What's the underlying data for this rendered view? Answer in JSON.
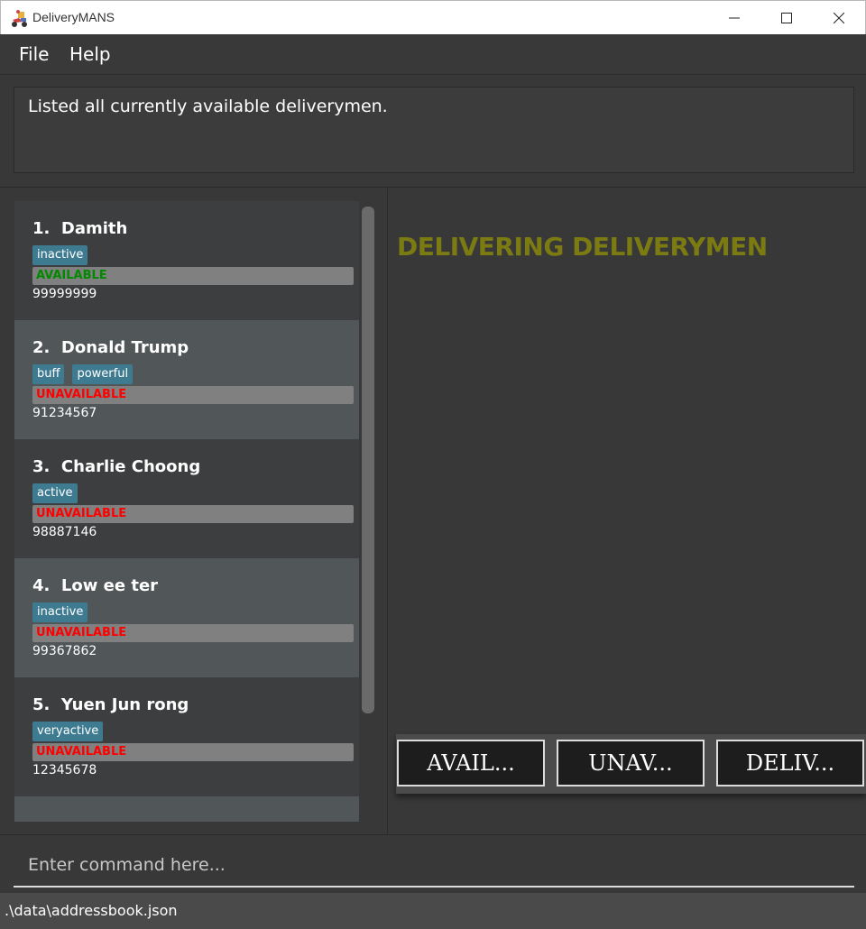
{
  "window": {
    "title": "DeliveryMANS"
  },
  "menu": {
    "file": "File",
    "help": "Help"
  },
  "result": {
    "message": "Listed all currently available deliverymen."
  },
  "deliverymen": [
    {
      "index": "1.",
      "name": "Damith",
      "tags": [
        "inactive"
      ],
      "status": "AVAILABLE",
      "phone": "99999999"
    },
    {
      "index": "2.",
      "name": "Donald Trump",
      "tags": [
        "buff",
        "powerful"
      ],
      "status": "UNAVAILABLE",
      "phone": "91234567"
    },
    {
      "index": "3.",
      "name": "Charlie Choong",
      "tags": [
        "active"
      ],
      "status": "UNAVAILABLE",
      "phone": "98887146"
    },
    {
      "index": "4.",
      "name": "Low ee ter",
      "tags": [
        "inactive"
      ],
      "status": "UNAVAILABLE",
      "phone": "99367862"
    },
    {
      "index": "5.",
      "name": "Yuen Jun rong",
      "tags": [
        "veryactive"
      ],
      "status": "UNAVAILABLE",
      "phone": "12345678"
    }
  ],
  "right_panel": {
    "title": "DELIVERING DELIVERYMEN",
    "buttons": {
      "available": "AVAIL...",
      "unavailable": "UNAV...",
      "delivering": "DELIV..."
    }
  },
  "command": {
    "placeholder": "Enter command here..."
  },
  "statusbar": {
    "path": ".\\data\\addressbook.json"
  },
  "colors": {
    "tag": "#3e7b91",
    "available": "#008a00",
    "unavailable": "#ff0000",
    "title_accent": "#7b7b12"
  }
}
